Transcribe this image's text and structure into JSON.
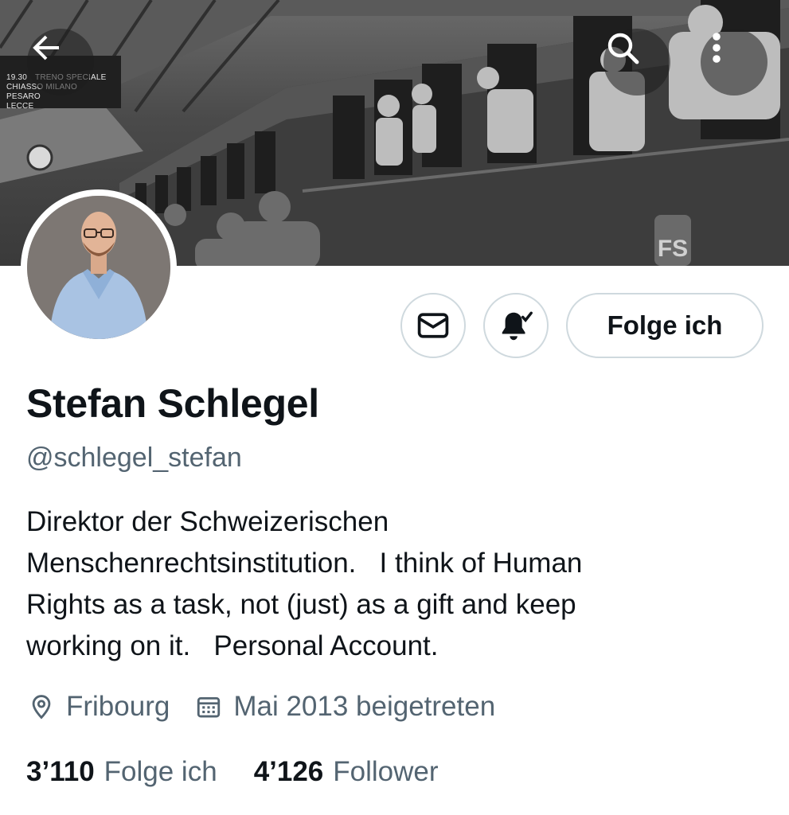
{
  "banner": {
    "sign": {
      "line1": [
        "19.30",
        "TRENO SPECIALE"
      ],
      "line2": [
        "CHIASSO MILANO",
        "PESARO"
      ],
      "line3": [
        "LECCE"
      ]
    },
    "train_logo": "FS"
  },
  "nav": {
    "back_icon": "arrow-left-icon",
    "search_icon": "search-icon",
    "more_icon": "more-vertical-icon"
  },
  "profile": {
    "display_name": "Stefan Schlegel",
    "handle": "@schlegel_stefan",
    "bio_lines": [
      "Direktor der Schweizerischen",
      "Menschenrechtsinstitution.   I think of Human",
      "Rights as a task, not (just) as a gift and keep",
      "working on it.   Personal Account."
    ],
    "location": "Fribourg",
    "joined": "Mai 2013 beigetreten"
  },
  "actions": {
    "message_icon": "envelope-icon",
    "notify_icon": "bell-check-icon",
    "follow_label": "Folge ich"
  },
  "stats": {
    "following_count": "3’110",
    "following_label": "Folge ich",
    "followers_count": "4’126",
    "followers_label": "Follower"
  },
  "colors": {
    "text_primary": "#0f1419",
    "text_secondary": "#536471",
    "border": "#cfd9de"
  }
}
